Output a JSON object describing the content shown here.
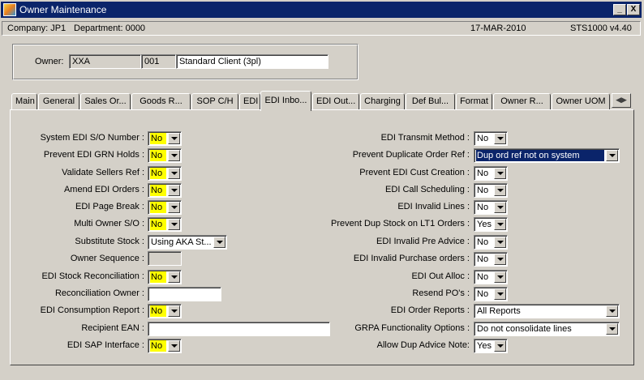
{
  "window": {
    "title": "Owner Maintenance",
    "minimize": "_",
    "close": "X"
  },
  "infobar": {
    "company": "Company:  JP1",
    "department": "Department:  0000",
    "date": "17-MAR-2010",
    "version": "STS1000  v4.40"
  },
  "owner": {
    "label": "Owner:",
    "code": "XXA",
    "number": "001",
    "name": "Standard Client (3pl)"
  },
  "tabs": [
    "Main",
    "General",
    "Sales Or...",
    "Goods R...",
    "SOP C/H",
    "EDI",
    "EDI Inbo...",
    "EDI Out...",
    "Charging",
    "Def Bul...",
    "Format",
    "Owner R...",
    "Owner UOM"
  ],
  "active_tab": "EDI Inbo...",
  "left_fields": [
    {
      "label": "System EDI S/O Number :",
      "value": "No"
    },
    {
      "label": "Prevent EDI GRN Holds :",
      "value": "No"
    },
    {
      "label": "Validate Sellers Ref :",
      "value": "No"
    },
    {
      "label": "Amend EDI Orders :",
      "value": "No"
    },
    {
      "label": "EDI Page Break :",
      "value": "No"
    },
    {
      "label": "Multi Owner S/O :",
      "value": "No"
    },
    {
      "label": "Substitute Stock :",
      "value": "Using AKA St..."
    },
    {
      "label": "Owner Sequence :",
      "value": ""
    },
    {
      "label": "EDI Stock Reconciliation :",
      "value": "No"
    },
    {
      "label": "Reconciliation Owner :",
      "value": ""
    },
    {
      "label": "EDI Consumption Report :",
      "value": "No"
    },
    {
      "label": "Recipient EAN :",
      "value": ""
    },
    {
      "label": "EDI SAP Interface :",
      "value": "No"
    }
  ],
  "right_fields": [
    {
      "label": "EDI Transmit Method :",
      "value": "No"
    },
    {
      "label": "Prevent Duplicate Order Ref :",
      "value": "Dup ord ref not on system"
    },
    {
      "label": "Prevent EDI Cust Creation :",
      "value": "No"
    },
    {
      "label": "EDI Call Scheduling :",
      "value": "No"
    },
    {
      "label": "EDI Invalid Lines :",
      "value": "No"
    },
    {
      "label": "Prevent Dup Stock on LT1 Orders :",
      "value": "Yes"
    },
    {
      "label": "EDI Invalid Pre Advice :",
      "value": "No"
    },
    {
      "label": "EDI Invalid Purchase orders :",
      "value": "No"
    },
    {
      "label": "EDI Out Alloc :",
      "value": "No"
    },
    {
      "label": "Resend PO's :",
      "value": "No"
    },
    {
      "label": "EDI Order Reports :",
      "value": "All Reports"
    },
    {
      "label": "GRPA Functionality Options :",
      "value": "Do not consolidate lines"
    },
    {
      "label": "Allow Dup Advice Note:",
      "value": "Yes"
    }
  ],
  "colors": {
    "titlebar": "#0a246a",
    "highlight_yellow": "#ffff00",
    "face": "#d4d0c8"
  }
}
